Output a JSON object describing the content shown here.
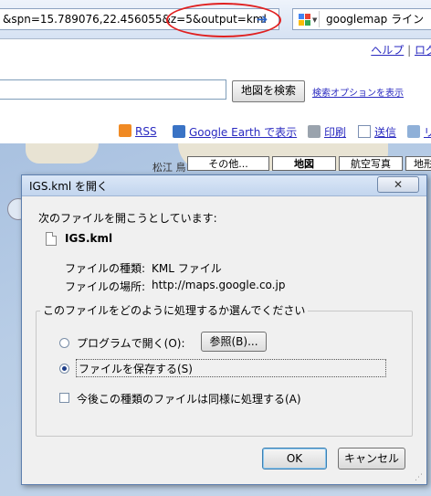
{
  "browser": {
    "address_value": "&spn=15.789076,22.456055&z=5&output=kml",
    "search_value": "googlemap ライン"
  },
  "maps": {
    "top_links": [
      "ヘルプ",
      "ログ"
    ],
    "search_button": "地図を検索",
    "advanced_link": "検索オプションを表示",
    "link_bar": {
      "rss": "RSS",
      "google_earth": "Google Earth で表示",
      "print": "印刷",
      "send": "送信",
      "link": "リ"
    },
    "map_types": {
      "more": "その他...",
      "map": "地図",
      "satellite": "航空写真",
      "terrain": "地形"
    },
    "map_label": "松江 鳥"
  },
  "dialog": {
    "title": "IGS.kml を開く",
    "close_glyph": "✕",
    "intro": "次のファイルを開こうとしています:",
    "file_name": "IGS.kml",
    "type_label": "ファイルの種類:",
    "type_value": "KML ファイル",
    "location_label": "ファイルの場所:",
    "location_value": "http://maps.google.co.jp",
    "group_title": "このファイルをどのように処理するか選んでください",
    "open_with_label": "プログラムで開く(O):",
    "browse_button": "参照(B)...",
    "save_label": "ファイルを保存する(S)",
    "remember_label": "今後この種類のファイルは同様に処理する(A)",
    "ok_button": "OK",
    "cancel_button": "キャンセル",
    "selected_option": "save",
    "remember_checked": false
  },
  "colors": {
    "annotation": "#e02020",
    "link": "#2a2ac0",
    "dialog_border": "#5d7fae"
  }
}
